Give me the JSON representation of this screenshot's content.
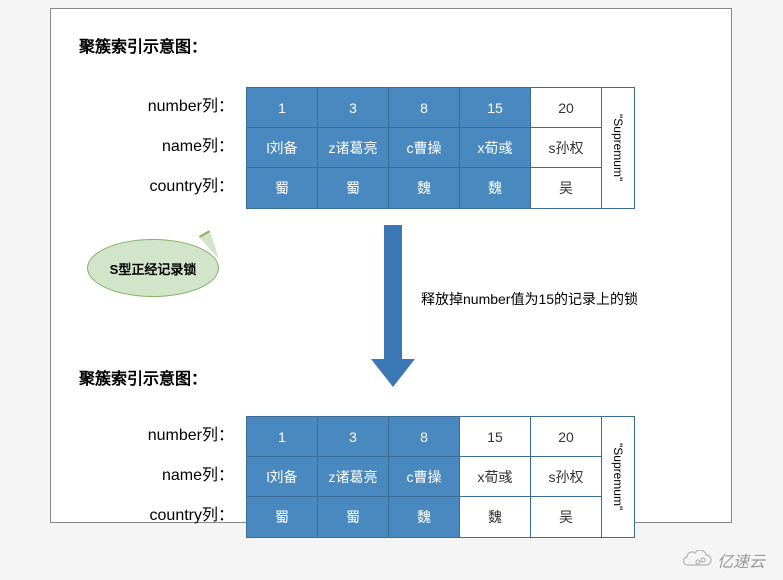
{
  "title_top": "聚簇索引示意图：",
  "title_bot": "聚簇索引示意图：",
  "row_labels": {
    "number": "number列：",
    "name": "name列：",
    "country": "country列："
  },
  "supremum": "\"Supremum\"",
  "bubble_text": "S型正经记录锁",
  "arrow_note": "释放掉number值为15的记录上的锁",
  "top_table": {
    "cols": [
      {
        "locked": true,
        "number": "1",
        "name": "l刘备",
        "country": "蜀"
      },
      {
        "locked": true,
        "number": "3",
        "name": "z诸葛亮",
        "country": "蜀"
      },
      {
        "locked": true,
        "number": "8",
        "name": "c曹操",
        "country": "魏"
      },
      {
        "locked": true,
        "number": "15",
        "name": "x荀彧",
        "country": "魏"
      },
      {
        "locked": false,
        "number": "20",
        "name": "s孙权",
        "country": "吴"
      }
    ]
  },
  "bot_table": {
    "cols": [
      {
        "locked": true,
        "number": "1",
        "name": "l刘备",
        "country": "蜀"
      },
      {
        "locked": true,
        "number": "3",
        "name": "z诸葛亮",
        "country": "蜀"
      },
      {
        "locked": true,
        "number": "8",
        "name": "c曹操",
        "country": "魏"
      },
      {
        "locked": false,
        "number": "15",
        "name": "x荀彧",
        "country": "魏"
      },
      {
        "locked": false,
        "number": "20",
        "name": "s孙权",
        "country": "吴"
      }
    ]
  },
  "logo": "亿速云",
  "chart_data": {
    "type": "table",
    "description": "Two clustered-index record diagrams before and after releasing the S-lock on record with number=15",
    "columns": [
      "number",
      "name",
      "country"
    ],
    "before": {
      "locked_numbers": [
        1,
        3,
        8,
        15
      ],
      "records": [
        {
          "number": 1,
          "name": "l刘备",
          "country": "蜀"
        },
        {
          "number": 3,
          "name": "z诸葛亮",
          "country": "蜀"
        },
        {
          "number": 8,
          "name": "c曹操",
          "country": "魏"
        },
        {
          "number": 15,
          "name": "x荀彧",
          "country": "魏"
        },
        {
          "number": 20,
          "name": "s孙权",
          "country": "吴"
        }
      ],
      "supremum": "Supremum"
    },
    "after": {
      "locked_numbers": [
        1,
        3,
        8
      ],
      "records": [
        {
          "number": 1,
          "name": "l刘备",
          "country": "蜀"
        },
        {
          "number": 3,
          "name": "z诸葛亮",
          "country": "蜀"
        },
        {
          "number": 8,
          "name": "c曹操",
          "country": "魏"
        },
        {
          "number": 15,
          "name": "x荀彧",
          "country": "魏"
        },
        {
          "number": 20,
          "name": "s孙权",
          "country": "吴"
        }
      ],
      "supremum": "Supremum"
    },
    "locked_fill": "#4a89c0",
    "unlocked_fill": "#ffffff"
  }
}
